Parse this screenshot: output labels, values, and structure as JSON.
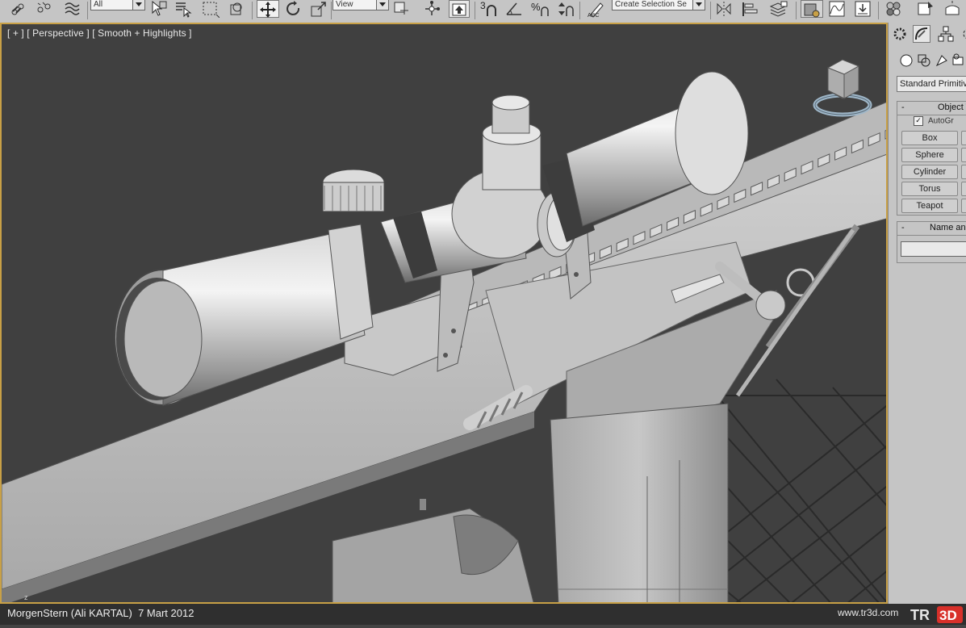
{
  "toolbar": {
    "selection_filter": "All",
    "reference_coord": "View",
    "named_selection_placeholder": "Create Selection Se"
  },
  "viewport": {
    "label_plus": "[ + ]",
    "label_view": "[ Perspective ]",
    "label_shading": "[ Smooth + Highlights ]",
    "axis_label": "z"
  },
  "command_panel": {
    "category": "Standard Primitives",
    "object_type_header": "Object T",
    "autogrid_label": "AutoGr",
    "autogrid_checked": "✓",
    "buttons": [
      "Box",
      "Sphere",
      "Cylinder",
      "Torus",
      "Teapot"
    ],
    "name_header": "Name and"
  },
  "status": {
    "credit": "MorgenStern (Ali KARTAL)  7 Mart 2012",
    "website": "www.tr3d.com",
    "logo_text_1": "TR",
    "logo_text_2": "3D"
  },
  "colors": {
    "viewport_border": "#c8a046",
    "viewport_bg": "#404040",
    "toolbar_bg": "#c5c5c5",
    "statusbar_bg": "#2f2f2f",
    "logo_red": "#d8302a"
  }
}
